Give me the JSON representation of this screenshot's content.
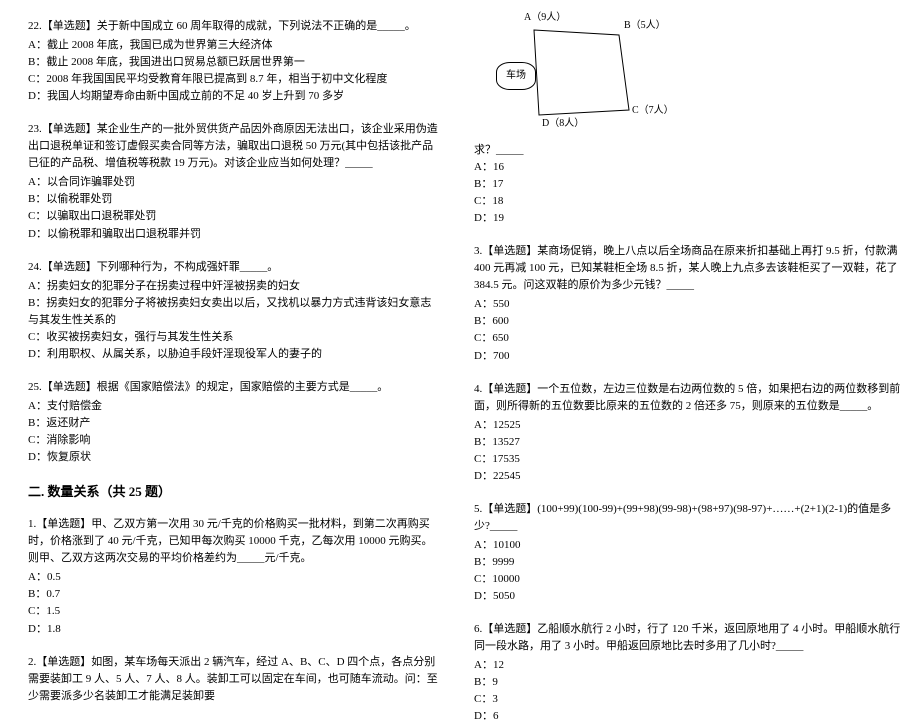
{
  "left": {
    "q22": {
      "stem": "22.【单选题】关于新中国成立 60 周年取得的成就，下列说法不正确的是_____。",
      "A": "A：截止 2008 年底，我国已成为世界第三大经济体",
      "B": "B：截止 2008 年底，我国进出口贸易总额已跃居世界第一",
      "C": "C：2008 年我国国民平均受教育年限已提高到 8.7 年，相当于初中文化程度",
      "D": "D：我国人均期望寿命由新中国成立前的不足 40 岁上升到 70 多岁"
    },
    "q23": {
      "stem": "23.【单选题】某企业生产的一批外贸供货产品因外商原因无法出口，该企业采用伪造出口退税单证和签订虚假买卖合同等方法，骗取出口退税 50 万元(其中包括该批产品已征的产品税、增值税等税款 19 万元)。对该企业应当如何处理？_____",
      "A": "A：以合同诈骗罪处罚",
      "B": "B：以偷税罪处罚",
      "C": "C：以骗取出口退税罪处罚",
      "D": "D：以偷税罪和骗取出口退税罪并罚"
    },
    "q24": {
      "stem": "24.【单选题】下列哪种行为，不构成强奸罪_____。",
      "A": "A：拐卖妇女的犯罪分子在拐卖过程中奸淫被拐卖的妇女",
      "B": "B：拐卖妇女的犯罪分子将被拐卖妇女卖出以后，又找机以暴力方式违背该妇女意志与其发生性关系的",
      "C": "C：收买被拐卖妇女，强行与其发生性关系",
      "D": "D：利用职权、从属关系，以胁迫手段奸淫现役军人的妻子的"
    },
    "q25": {
      "stem": "25.【单选题】根据《国家赔偿法》的规定，国家赔偿的主要方式是_____。",
      "A": "A：支付赔偿金",
      "B": "B：返还财产",
      "C": "C：消除影响",
      "D": "D：恢复原状"
    },
    "section2": "二. 数量关系（共 25 题）",
    "q1": {
      "stem": "1.【单选题】甲、乙双方第一次用 30 元/千克的价格购买一批材料，到第二次再购买时，价格涨到了 40 元/千克，已知甲每次购买 10000 千克，乙每次用 10000 元购买。则甲、乙双方这两次交易的平均价格差约为_____元/千克。",
      "A": "A：0.5",
      "B": "B：0.7",
      "C": "C：1.5",
      "D": "D：1.8"
    },
    "q2": {
      "stem": "2.【单选题】如图，某车场每天派出 2 辆汽车，经过 A、B、C、D 四个点，各点分别需要装卸工 9 人、5 人、7 人、8 人。装卸工可以固定在车间，也可随车流动。问：至少需要派多少名装卸工才能满足装卸要"
    }
  },
  "diagram": {
    "A": "A（9人）",
    "B": "B（5人）",
    "C": "C（7人）",
    "D": "D（8人）",
    "carfield": "车场"
  },
  "right": {
    "q2tail": {
      "qiu": "求？_____",
      "A": "A：16",
      "B": "B：17",
      "C": "C：18",
      "D": "D：19"
    },
    "q3": {
      "stem": "3.【单选题】某商场促销，晚上八点以后全场商品在原来折扣基础上再打 9.5 折，付款满 400 元再减 100 元，已知某鞋柜全场 8.5 折，某人晚上九点多去该鞋柜买了一双鞋，花了 384.5 元。问这双鞋的原价为多少元钱？_____",
      "A": "A：550",
      "B": "B：600",
      "C": "C：650",
      "D": "D：700"
    },
    "q4": {
      "stem": "4.【单选题】一个五位数，左边三位数是右边两位数的 5 倍，如果把右边的两位数移到前面，则所得新的五位数要比原来的五位数的 2 倍还多 75，则原来的五位数是_____。",
      "A": "A：12525",
      "B": "B：13527",
      "C": "C：17535",
      "D": "D：22545"
    },
    "q5": {
      "stem": "5.【单选题】(100+99)(100-99)+(99+98)(99-98)+(98+97)(98-97)+……+(2+1)(2-1)的值是多少?_____",
      "A": "A：10100",
      "B": "B：9999",
      "C": "C：10000",
      "D": "D：5050"
    },
    "q6": {
      "stem": "6.【单选题】乙船顺水航行 2 小时，行了 120 千米，返回原地用了 4 小时。甲船顺水航行同一段水路，用了 3 小时。甲船返回原地比去时多用了几小时?_____",
      "A": "A：12",
      "B": "B：9",
      "C": "C：3",
      "D": "D：6"
    }
  }
}
